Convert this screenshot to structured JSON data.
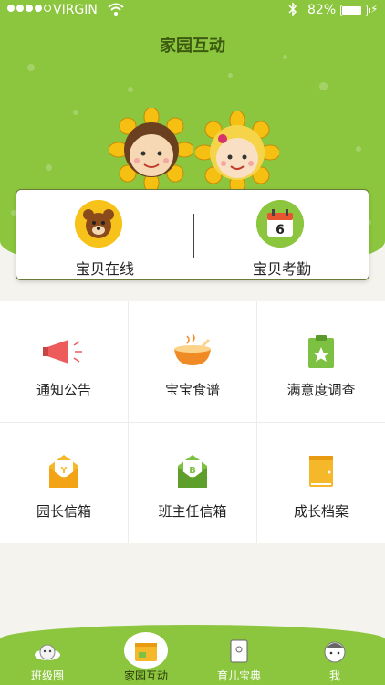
{
  "status_bar": {
    "carrier": "VIRGIN",
    "battery_text": "82%",
    "battery_level": 0.82
  },
  "header": {
    "title": "家园互动"
  },
  "top_card": {
    "left": {
      "label": "宝贝在线",
      "icon": "bear-icon"
    },
    "right": {
      "label": "宝贝考勤",
      "icon": "calendar-icon",
      "day_number": "6"
    }
  },
  "grid": [
    {
      "label": "通知公告",
      "icon": "megaphone-icon"
    },
    {
      "label": "宝宝食谱",
      "icon": "food-bowl-icon"
    },
    {
      "label": "满意度调查",
      "icon": "clipboard-star-icon"
    },
    {
      "label": "园长信箱",
      "icon": "envelope-y-icon",
      "badge": "Y"
    },
    {
      "label": "班主任信箱",
      "icon": "envelope-b-icon",
      "badge": "B"
    },
    {
      "label": "成长档案",
      "icon": "archive-book-icon"
    }
  ],
  "tabbar": [
    {
      "label": "班级圈",
      "icon": "planet-icon"
    },
    {
      "label": "家园互动",
      "icon": "home-book-icon",
      "active": true
    },
    {
      "label": "育儿宝典",
      "icon": "book-icon"
    },
    {
      "label": "我",
      "icon": "avatar-icon"
    }
  ],
  "colors": {
    "brand_green": "#8cc63e",
    "accent_yellow": "#f7c21a",
    "title_dark": "#3c5a10"
  }
}
